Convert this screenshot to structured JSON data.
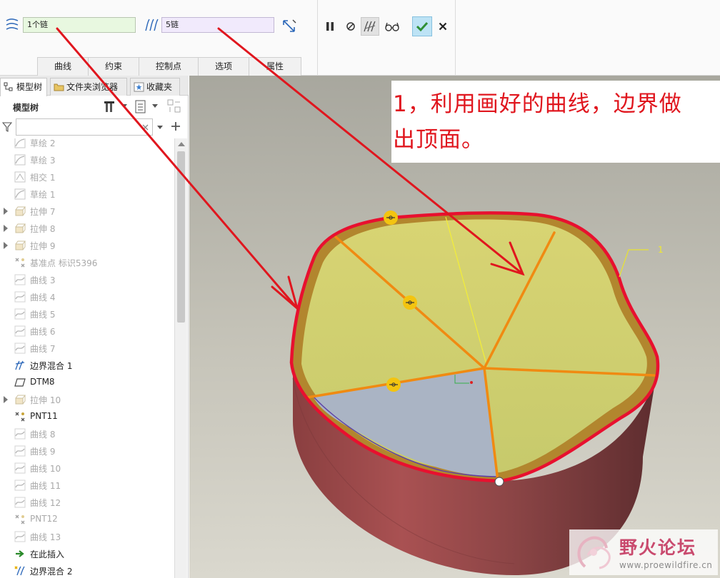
{
  "ribbon": {
    "chain_first_value": "1个链",
    "chain_second_value": "5链",
    "tabs": [
      {
        "label": "曲线",
        "width": 72
      },
      {
        "label": "约束",
        "width": 72
      },
      {
        "label": "控制点",
        "width": 84
      },
      {
        "label": "选项",
        "width": 72
      },
      {
        "label": "属性",
        "width": 74
      }
    ]
  },
  "panel": {
    "tabs": {
      "model_tree": "模型树",
      "folder_browser": "文件夹浏览器",
      "favorites": "收藏夹"
    },
    "tree_title": "模型树",
    "filter_value": "",
    "items": [
      {
        "label": "草绘 2",
        "icon": "sketch-icon",
        "dim": true,
        "expand": false
      },
      {
        "label": "草绘 3",
        "icon": "sketch-icon",
        "dim": true,
        "expand": false
      },
      {
        "label": "相交 1",
        "icon": "intersect-icon",
        "dim": true,
        "expand": false
      },
      {
        "label": "草绘 1",
        "icon": "sketch-icon",
        "dim": true,
        "expand": false
      },
      {
        "label": "拉伸 7",
        "icon": "extrude-icon",
        "dim": true,
        "expand": true
      },
      {
        "label": "拉伸 8",
        "icon": "extrude-icon",
        "dim": true,
        "expand": true
      },
      {
        "label": "拉伸 9",
        "icon": "extrude-icon",
        "dim": true,
        "expand": true
      },
      {
        "label": "基准点 标识5396",
        "icon": "datum-point-icon",
        "dim": true,
        "expand": false
      },
      {
        "label": "曲线 3",
        "icon": "curve-icon",
        "dim": true,
        "expand": false
      },
      {
        "label": "曲线 4",
        "icon": "curve-icon",
        "dim": true,
        "expand": false
      },
      {
        "label": "曲线 5",
        "icon": "curve-icon",
        "dim": true,
        "expand": false
      },
      {
        "label": "曲线 6",
        "icon": "curve-icon",
        "dim": true,
        "expand": false
      },
      {
        "label": "曲线 7",
        "icon": "curve-icon",
        "dim": true,
        "expand": false
      },
      {
        "label": "边界混合 1",
        "icon": "boundary-blend-icon",
        "dim": false,
        "expand": false
      },
      {
        "label": "DTM8",
        "icon": "datum-plane-icon",
        "dim": false,
        "expand": false
      },
      {
        "label": "拉伸 10",
        "icon": "extrude-icon",
        "dim": true,
        "expand": true
      },
      {
        "label": "PNT11",
        "icon": "datum-point-icon",
        "dim": false,
        "expand": false
      },
      {
        "label": "曲线 8",
        "icon": "curve-icon",
        "dim": true,
        "expand": false
      },
      {
        "label": "曲线 9",
        "icon": "curve-icon",
        "dim": true,
        "expand": false
      },
      {
        "label": "曲线 10",
        "icon": "curve-icon",
        "dim": true,
        "expand": false
      },
      {
        "label": "曲线 11",
        "icon": "curve-icon",
        "dim": true,
        "expand": false
      },
      {
        "label": "曲线 12",
        "icon": "curve-icon",
        "dim": true,
        "expand": false
      },
      {
        "label": "PNT12",
        "icon": "datum-point-icon",
        "dim": true,
        "expand": false
      },
      {
        "label": "曲线 13",
        "icon": "curve-icon",
        "dim": true,
        "expand": false
      },
      {
        "label": "在此插入",
        "icon": "insert-here-arrow-icon",
        "dim": false,
        "expand": false
      },
      {
        "label": "边界混合 2",
        "icon": "boundary-blend-new-icon",
        "dim": false,
        "expand": false
      }
    ]
  },
  "viewport": {
    "note_line1": "1，利用画好的曲线，边界做",
    "note_line2": "出顶面。",
    "dimension_label": "1"
  },
  "watermark": {
    "name": "野火论坛",
    "url": "www.proewildfire.cn"
  },
  "colors": {
    "annotation_red": "#e0161e",
    "boundary_red": "#e8102f",
    "chain_orange": "#f08a12",
    "surface_yellow": "#cfd06c",
    "body_red": "#9c4a4b",
    "lid_gray_blue": "#aab4c4"
  }
}
